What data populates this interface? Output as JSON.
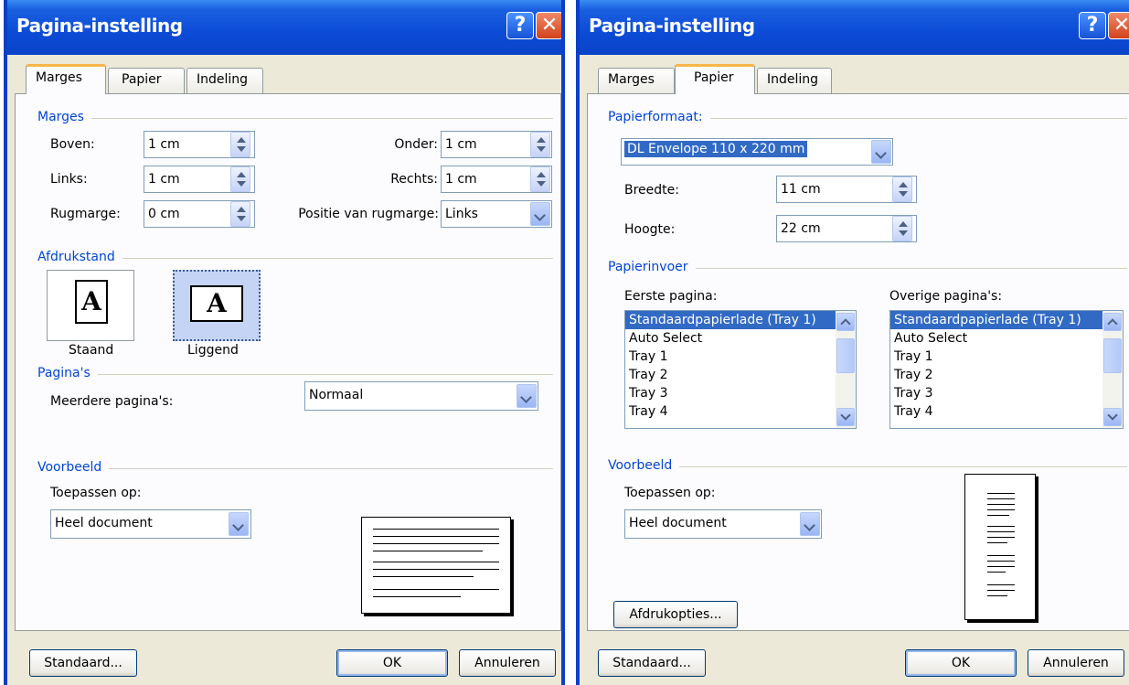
{
  "left": {
    "title": "Pagina-instelling",
    "tabs": [
      "Marges",
      "Papier",
      "Indeling"
    ],
    "active_tab": "Marges",
    "groups": {
      "marges": "Marges",
      "afdrukstand": "Afdrukstand",
      "paginas": "Pagina's",
      "voorbeeld": "Voorbeeld"
    },
    "fields": {
      "boven": {
        "label": "Boven:",
        "value": "1 cm"
      },
      "links": {
        "label": "Links:",
        "value": "1 cm"
      },
      "rugmarge": {
        "label": "Rugmarge:",
        "value": "0 cm"
      },
      "onder": {
        "label": "Onder:",
        "value": "1 cm"
      },
      "rechts": {
        "label": "Rechts:",
        "value": "1 cm"
      },
      "positie": {
        "label": "Positie van rugmarge:",
        "value": "Links"
      }
    },
    "orientation": {
      "staand": "Staand",
      "liggend": "Liggend",
      "selected": "Liggend"
    },
    "meerdere": {
      "label": "Meerdere pagina's:",
      "value": "Normaal"
    },
    "toepassen": {
      "label": "Toepassen op:",
      "value": "Heel document"
    },
    "buttons": {
      "standaard": "Standaard...",
      "ok": "OK",
      "annuleren": "Annuleren"
    }
  },
  "right": {
    "title": "Pagina-instelling",
    "tabs": [
      "Marges",
      "Papier",
      "Indeling"
    ],
    "active_tab": "Papier",
    "groups": {
      "papierformaat": "Papierformaat:",
      "papierinvoer": "Papierinvoer",
      "voorbeeld": "Voorbeeld"
    },
    "papierformaat_value": "DL Envelope 110 x 220 mm",
    "breedte": {
      "label": "Breedte:",
      "value": "11 cm"
    },
    "hoogte": {
      "label": "Hoogte:",
      "value": "22 cm"
    },
    "eerste": {
      "label": "Eerste pagina:",
      "items": [
        "Standaardpapierlade (Tray 1)",
        "Auto Select",
        "Tray 1",
        "Tray 2",
        "Tray 3",
        "Tray 4"
      ]
    },
    "overige": {
      "label": "Overige pagina's:",
      "items": [
        "Standaardpapierlade (Tray 1)",
        "Auto Select",
        "Tray 1",
        "Tray 2",
        "Tray 3",
        "Tray 4"
      ]
    },
    "toepassen": {
      "label": "Toepassen op:",
      "value": "Heel document"
    },
    "afdrukopties": "Afdrukopties...",
    "buttons": {
      "standaard": "Standaard...",
      "ok": "OK",
      "annuleren": "Annuleren"
    }
  },
  "colors": {
    "titlebar": "#0a44c8",
    "group_text": "#0046d5",
    "selection": "#316ac5",
    "tab_highlight": "#f7b64a"
  },
  "icons": [
    "help-icon",
    "close-icon",
    "spin-updown-icon",
    "dropdown-arrow-icon",
    "portrait-page-icon",
    "landscape-page-icon"
  ]
}
